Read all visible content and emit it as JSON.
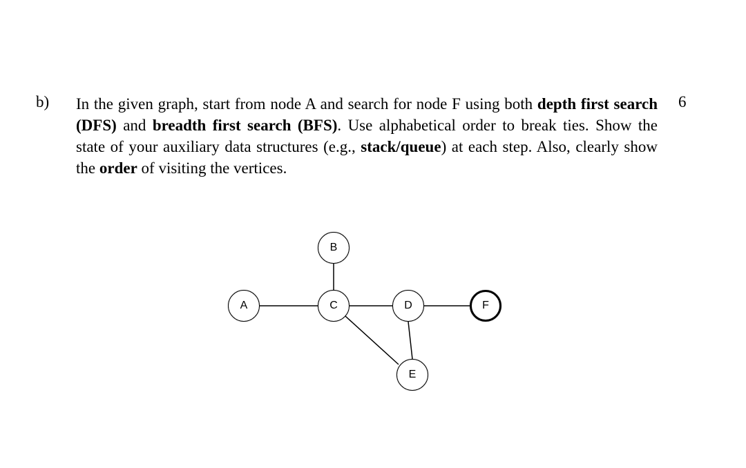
{
  "question": {
    "label": "b)",
    "points": "6",
    "text_parts": {
      "p1": "In the given graph, start from node A and search for node F using both ",
      "b1": "depth first search (DFS)",
      "p2": " and ",
      "b2": "breadth first search (BFS)",
      "p3": ". Use alphabetical order to break ties. Show the state of your auxiliary data structures (e.g., ",
      "b3": "stack/queue",
      "p4": ") at each step. Also, clearly show the ",
      "b4": "order",
      "p5": " of visiting the vertices."
    }
  },
  "graph": {
    "nodes": {
      "A": "A",
      "B": "B",
      "C": "C",
      "D": "D",
      "E": "E",
      "F": "F"
    },
    "edges": [
      [
        "A",
        "C"
      ],
      [
        "B",
        "C"
      ],
      [
        "C",
        "D"
      ],
      [
        "C",
        "E"
      ],
      [
        "D",
        "E"
      ],
      [
        "D",
        "F"
      ]
    ]
  }
}
